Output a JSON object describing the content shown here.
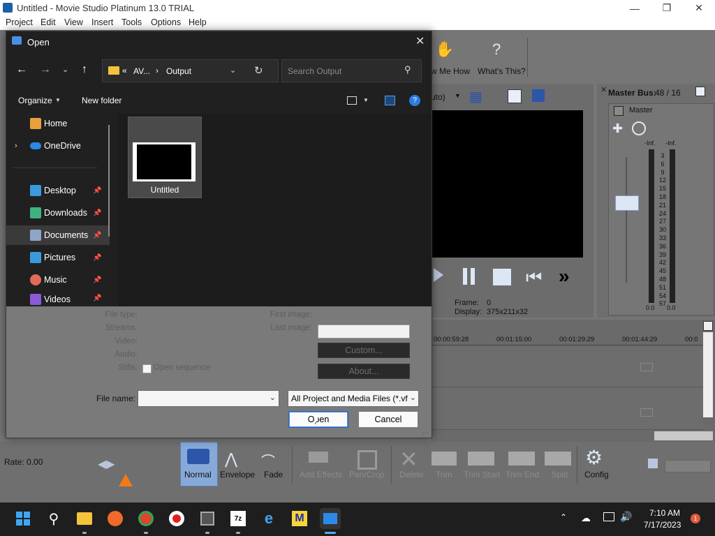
{
  "app": {
    "title": "Untitled - Movie Studio Platinum 13.0 TRIAL",
    "menu": [
      "Project",
      "Edit",
      "View",
      "Insert",
      "Tools",
      "Options",
      "Help"
    ],
    "toolbar": {
      "show_me_how": "w Me How",
      "whats_this": "What's This?"
    },
    "preview": {
      "zoom": "uto)",
      "frame_label": "Frame:",
      "frame_value": "0",
      "display_label": "Display:",
      "display_value": "375x211x32"
    },
    "master_bus": {
      "title": "Master Bus:",
      "value": "48 / 16",
      "master_label": "Master",
      "inf_left": "-Inf.",
      "inf_right": "-Inf.",
      "scale": [
        "3",
        "6",
        "9",
        "12",
        "15",
        "18",
        "21",
        "24",
        "27",
        "30",
        "33",
        "36",
        "39",
        "42",
        "45",
        "48",
        "51",
        "54",
        "57"
      ],
      "bottom_left": "0.0",
      "bottom_right": "0.0"
    },
    "timeline": {
      "ticks": [
        "00:00:59:28",
        "00:01:15:00",
        "00:01:29:29",
        "00:01:44:29",
        "00:0"
      ]
    },
    "bottom": {
      "rate": "Rate: 0.00",
      "tools": [
        "Normal",
        "Envelope",
        "Fade",
        "Add Effects",
        "Pan/Crop",
        "Delete",
        "Trim",
        "Trim Start",
        "Trim End",
        "Split",
        "Config"
      ]
    }
  },
  "dialog": {
    "title": "Open",
    "breadcrumb": {
      "root": "AV...",
      "current": "Output"
    },
    "search_placeholder": "Search Output",
    "organize": "Organize",
    "new_folder": "New folder",
    "nav": [
      {
        "label": "Home",
        "icon": "home-icon",
        "color": "#e8a13c"
      },
      {
        "label": "OneDrive",
        "icon": "cloud-icon",
        "color": "#2b8ae6"
      },
      {
        "label": "Desktop",
        "icon": "desktop-icon",
        "color": "#3a9bdc"
      },
      {
        "label": "Downloads",
        "icon": "download-icon",
        "color": "#3fb27f"
      },
      {
        "label": "Documents",
        "icon": "document-icon",
        "color": "#8fa6c8"
      },
      {
        "label": "Pictures",
        "icon": "picture-icon",
        "color": "#3a9bdc"
      },
      {
        "label": "Music",
        "icon": "music-icon",
        "color": "#e36b5b"
      },
      {
        "label": "Videos",
        "icon": "video-icon",
        "color": "#8a5ad8"
      }
    ],
    "file": {
      "name": "Untitled"
    },
    "props": {
      "file_type": "File type:",
      "streams": "Streams:",
      "video": "Video:",
      "audio": "Audio:",
      "stills": "Stills:",
      "open_sequence": "Open sequence",
      "first_image": "First image:",
      "last_image": "Last image:",
      "custom": "Custom...",
      "about": "About..."
    },
    "filename_label": "File name:",
    "filename_value": "",
    "filter": "All Project and Media Files (*.vf",
    "open": "Open",
    "cancel": "Cancel"
  },
  "taskbar": {
    "time": "7:10 AM",
    "date": "7/17/2023",
    "notification_count": "1"
  }
}
